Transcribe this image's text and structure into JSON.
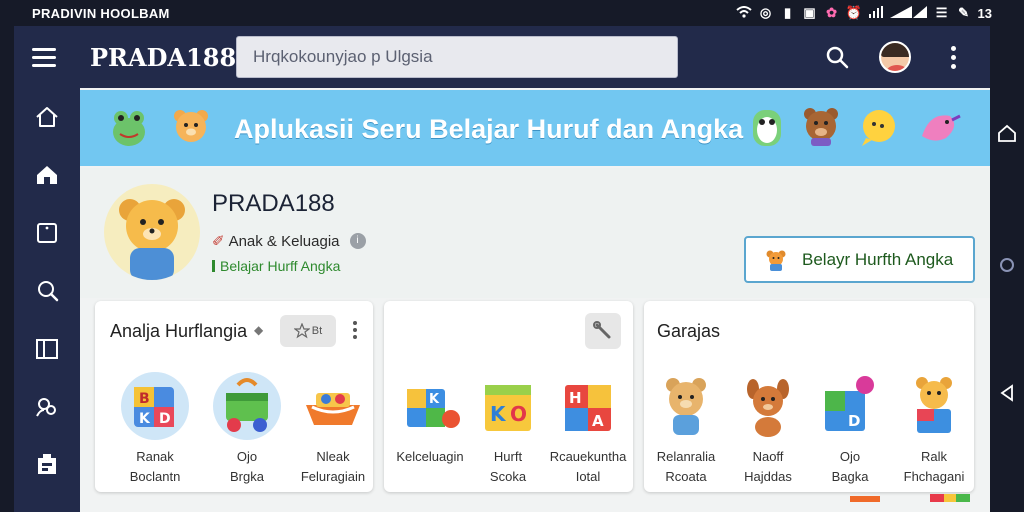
{
  "status_bar": {
    "left_text": "PRADIVIN HOOLBAM",
    "time": "13"
  },
  "app_bar": {
    "brand": "PRADA188",
    "search_placeholder": "Hrqkokounyjao p Ulgsia"
  },
  "banner": {
    "title": "Aplukasii Seru Belajar Huruf dan Angka"
  },
  "profile": {
    "name": "PRADA188",
    "category": "Anak & Keluagia",
    "tag": "Belajar Hurff Angka",
    "cta_label": "Belayr Hurfth Angka"
  },
  "cards": [
    {
      "title": "Analja Hurflangia",
      "chip_label": "Bt",
      "tiles": [
        {
          "line1": "Ranak",
          "line2": "Boclantn",
          "icon": "abc-block-ball-icon"
        },
        {
          "line1": "Ojo",
          "line2": "Brgka",
          "icon": "toy-cart-icon"
        },
        {
          "line1": "Nleak",
          "line2": "Feluragiain",
          "icon": "toy-boat-icon"
        }
      ]
    },
    {
      "title": "",
      "tiles": [
        {
          "line1": "Kelceluagin",
          "line2": "",
          "icon": "blocks-ball-icon"
        },
        {
          "line1": "Hurft",
          "line2": "Scoka",
          "icon": "letter-blocks-icon"
        },
        {
          "line1": "Rcauekuntha",
          "line2": "Iotal",
          "icon": "letter-cube-icon"
        }
      ]
    },
    {
      "title": "Garajas",
      "tiles": [
        {
          "line1": "Relanralia",
          "line2": "Rcoata",
          "icon": "bear-toy-icon"
        },
        {
          "line1": "Naoff",
          "line2": "Hajddas",
          "icon": "dog-toy-icon"
        },
        {
          "line1": "Ojo",
          "line2": "Bagka",
          "icon": "blocks-ball-icon"
        },
        {
          "line1": "Ralk",
          "line2": "Fhchagani",
          "icon": "bear-block-icon"
        }
      ]
    }
  ],
  "colors": {
    "app_bar": "#222a4a",
    "banner": "#72c7f1",
    "cta_border": "#5aa6cf",
    "tag_green": "#2e8a2e"
  }
}
